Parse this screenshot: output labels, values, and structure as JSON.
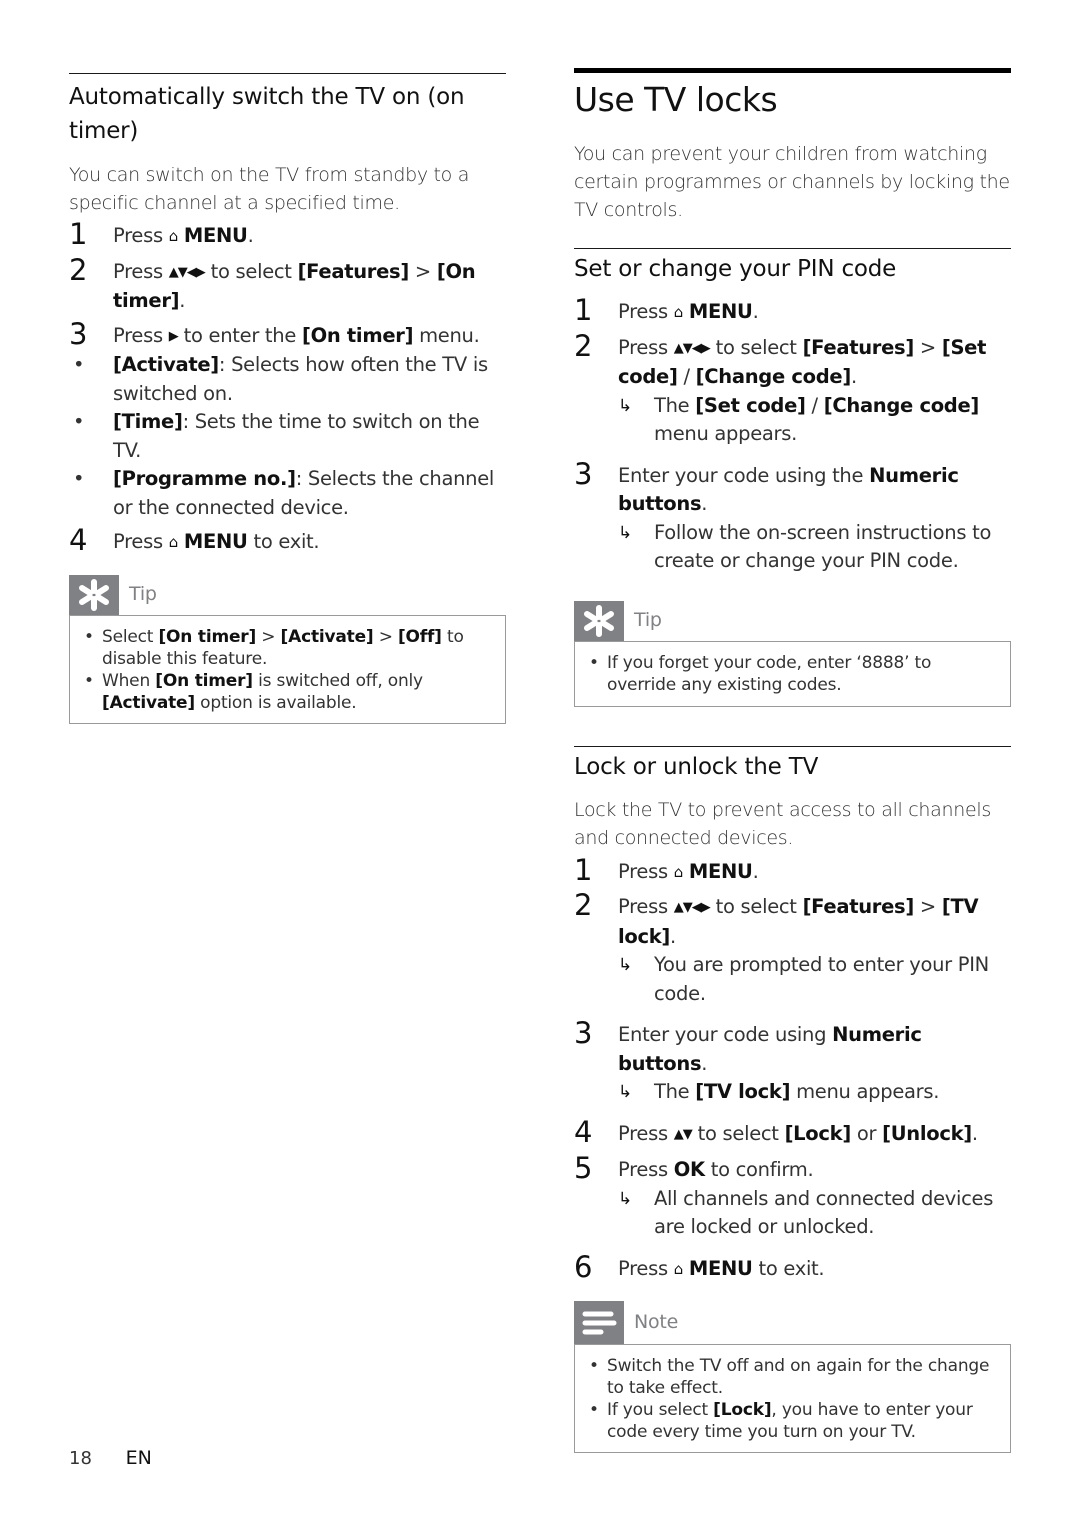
{
  "left": {
    "title": "Automatically switch the TV on (on timer)",
    "intro": "You can switch on the TV from standby to a specific channel at a specified time.",
    "steps": [
      {
        "num": "1",
        "pre": "Press",
        "key": "MENU",
        "post": "."
      },
      {
        "num": "2",
        "pre": "Press",
        "mid": "to select",
        "k1": "[Features]",
        "sep": ">",
        "k2": "[On timer]",
        "post": "."
      },
      {
        "num": "3",
        "pre": "Press",
        "mid": "to enter the",
        "k1": "[On timer]",
        "post": "menu."
      },
      {
        "num": "4",
        "pre": "Press",
        "key": "MENU",
        "post": "to exit."
      }
    ],
    "bullets": [
      {
        "key": "[Activate]",
        "text": ": Selects how often the TV is switched on."
      },
      {
        "key": "[Time]",
        "text": ": Sets the time to switch on the TV."
      },
      {
        "key": "[Programme no.]",
        "text": ": Selects the channel or the connected device."
      }
    ],
    "tip": {
      "label": "Tip",
      "items": [
        {
          "a": "Select",
          "k1": "[On timer]",
          "s1": ">",
          "k2": "[Activate]",
          "s2": ">",
          "k3": "[Off]",
          "b": "to disable this feature."
        },
        {
          "a": "When",
          "k1": "[On timer]",
          "b": "is switched off, only",
          "k2": "[Activate]",
          "c": "option is available."
        }
      ]
    }
  },
  "right": {
    "title": "Use TV locks",
    "intro": "You can prevent your children from watching certain programmes or channels by locking the TV controls.",
    "pin": {
      "title": "Set or change your PIN code",
      "s1": {
        "num": "1",
        "pre": "Press",
        "key": "MENU",
        "post": "."
      },
      "s2": {
        "num": "2",
        "pre": "Press",
        "mid": "to select",
        "k1": "[Features]",
        "sep": ">",
        "k2": "[Set code]",
        "slash": "/",
        "k3": "[Change code]",
        "post": "."
      },
      "s2_result": {
        "a": "The",
        "k1": "[Set code]",
        "slash": "/",
        "k2": "[Change code]",
        "b": "menu appears."
      },
      "s3": {
        "num": "3",
        "pre": "Enter your code using the",
        "key": "Numeric buttons",
        "post": "."
      },
      "s3_result": "Follow the on-screen instructions to create or change your PIN code."
    },
    "tip": {
      "label": "Tip",
      "item": "If you forget your code, enter ‘8888’ to override any existing codes."
    },
    "lock": {
      "title": "Lock or unlock the TV",
      "intro": "Lock the TV to prevent access to all channels and connected devices.",
      "s1": {
        "num": "1",
        "pre": "Press",
        "key": "MENU",
        "post": "."
      },
      "s2": {
        "num": "2",
        "pre": "Press",
        "mid": "to select",
        "k1": "[Features]",
        "sep": ">",
        "k2": "[TV lock]",
        "post": "."
      },
      "s2_result": "You are prompted to enter your PIN code.",
      "s3": {
        "num": "3",
        "pre": "Enter your code using",
        "key": "Numeric buttons",
        "post": "."
      },
      "s3_result": {
        "a": "The",
        "k1": "[TV lock]",
        "b": "menu appears."
      },
      "s4": {
        "num": "4",
        "pre": "Press",
        "mid": "to select",
        "k1": "[Lock]",
        "or": "or",
        "k2": "[Unlock]",
        "post": "."
      },
      "s5": {
        "num": "5",
        "pre": "Press",
        "key": "OK",
        "post": "to confirm."
      },
      "s5_result": "All channels and connected devices are locked or unlocked.",
      "s6": {
        "num": "6",
        "pre": "Press",
        "key": "MENU",
        "post": "to exit."
      }
    },
    "note": {
      "label": "Note",
      "items": [
        {
          "text": "Switch the TV off and on again for the change to take effect."
        },
        {
          "a": "If you select",
          "k": "[Lock]",
          "b": ", you have to enter your code every time you turn on your TV."
        }
      ]
    }
  },
  "icons": {
    "home": "⌂",
    "nav4": "▲▼◀▶",
    "nav2": "▲▼",
    "right": "▶",
    "result": "↳",
    "bullet": "•"
  },
  "footer": {
    "page": "18",
    "lang": "EN"
  }
}
